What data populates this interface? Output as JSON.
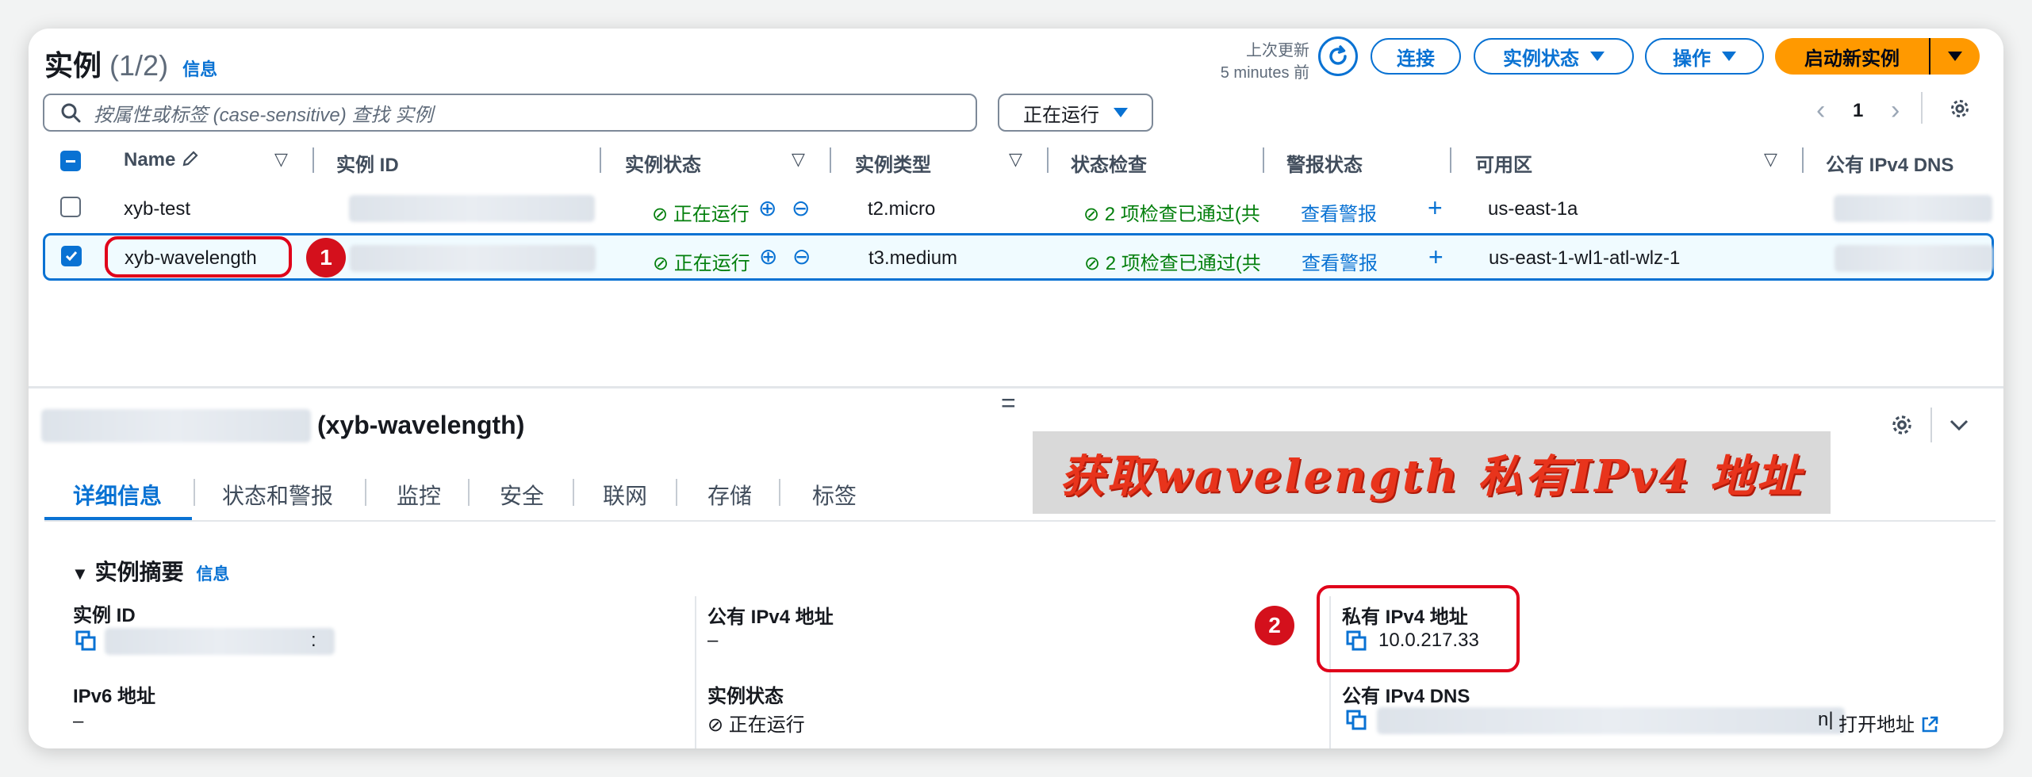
{
  "header": {
    "title": "实例",
    "count": "(1/2)",
    "info": "信息",
    "last_updated_label": "上次更新",
    "last_updated_value": "5 minutes 前",
    "connect": "连接",
    "instance_state": "实例状态",
    "actions": "操作",
    "launch": "启动新实例"
  },
  "search": {
    "placeholder": "按属性或标签 (case-sensitive) 查找 实例"
  },
  "filter": {
    "value": "正在运行"
  },
  "pagination": {
    "page": "1"
  },
  "table": {
    "columns": [
      "Name",
      "实例 ID",
      "实例状态",
      "实例类型",
      "状态检查",
      "警报状态",
      "可用区",
      "公有 IPv4 DNS"
    ],
    "rows": [
      {
        "name": "xyb-test",
        "state": "正在运行",
        "type": "t2.micro",
        "check": "2 项检查已通过(共",
        "alarm": "查看警报",
        "az": "us-east-1a",
        "selected": false
      },
      {
        "name": "xyb-wavelength",
        "state": "正在运行",
        "type": "t3.medium",
        "check": "2 项检查已通过(共",
        "alarm": "查看警报",
        "az": "us-east-1-wl1-atl-wlz-1",
        "selected": true
      }
    ]
  },
  "markers": {
    "one": "1",
    "two": "2"
  },
  "detail": {
    "resize_handle": "=",
    "title": "(xyb-wavelength)",
    "tabs": [
      "详细信息",
      "状态和警报",
      "监控",
      "安全",
      "联网",
      "存储",
      "标签"
    ],
    "annotation": "获取wavelength 私有IPv4 地址",
    "summary_title": "实例摘要",
    "summary_info": "信息",
    "instance_id_label": "实例 ID",
    "instance_id_suffix": ":",
    "ipv6_label": "IPv6 地址",
    "ipv6_value": "–",
    "public_ipv4_label": "公有 IPv4 地址",
    "public_ipv4_value": "–",
    "instance_state_label": "实例状态",
    "instance_state_value": "正在运行",
    "private_ipv4_label": "私有 IPv4 地址",
    "private_ipv4_value": "10.0.217.33",
    "public_dns_label": "公有 IPv4 DNS",
    "public_dns_tail": "n|",
    "open_address": "打开地址"
  },
  "colors": {
    "accent": "#0972d3",
    "launch": "#ff9900",
    "success": "#037f0c",
    "highlight": "#e0001a"
  }
}
